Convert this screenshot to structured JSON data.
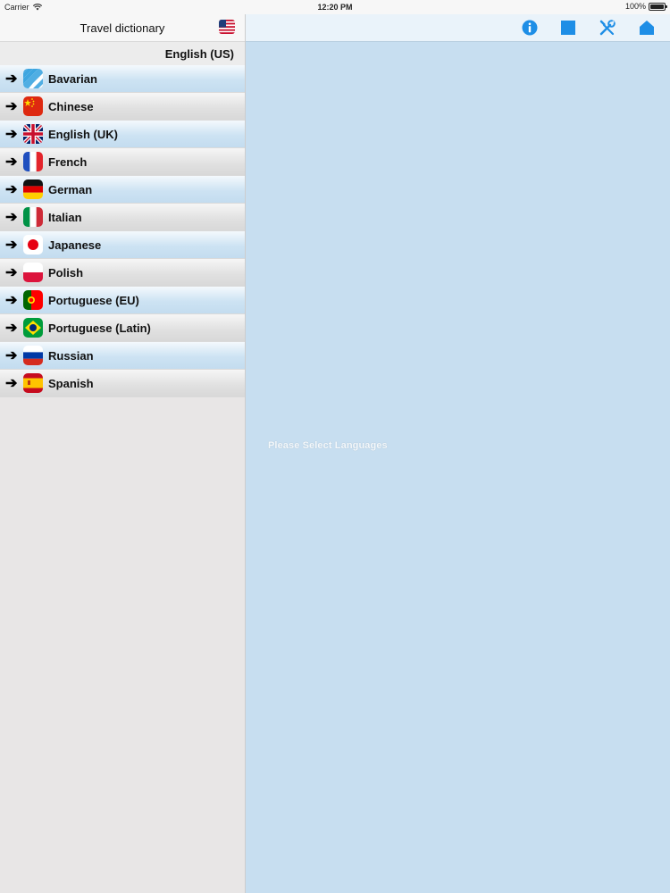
{
  "status_bar": {
    "carrier": "Carrier",
    "time": "12:20 PM",
    "battery": "100%"
  },
  "sidebar": {
    "title": "Travel dictionary",
    "source_language": "English (US)",
    "items": [
      {
        "label": "Bavarian",
        "flag": "bavaria-flag"
      },
      {
        "label": "Chinese",
        "flag": "china-flag"
      },
      {
        "label": "English (UK)",
        "flag": "uk-flag"
      },
      {
        "label": "French",
        "flag": "france-flag"
      },
      {
        "label": "German",
        "flag": "germany-flag"
      },
      {
        "label": "Italian",
        "flag": "italy-flag"
      },
      {
        "label": "Japanese",
        "flag": "japan-flag"
      },
      {
        "label": "Polish",
        "flag": "poland-flag"
      },
      {
        "label": "Portuguese (EU)",
        "flag": "portugal-flag"
      },
      {
        "label": "Portuguese (Latin)",
        "flag": "brazil-flag"
      },
      {
        "label": "Russian",
        "flag": "russia-flag"
      },
      {
        "label": "Spanish",
        "flag": "spain-flag"
      }
    ]
  },
  "toolbar": {
    "icons": [
      "info-icon",
      "square-icon",
      "tools-icon",
      "home-icon"
    ]
  },
  "main": {
    "message": "Please Select Languages"
  },
  "colors": {
    "accent": "#1e8ee6",
    "panel_bg": "#c7def0"
  }
}
